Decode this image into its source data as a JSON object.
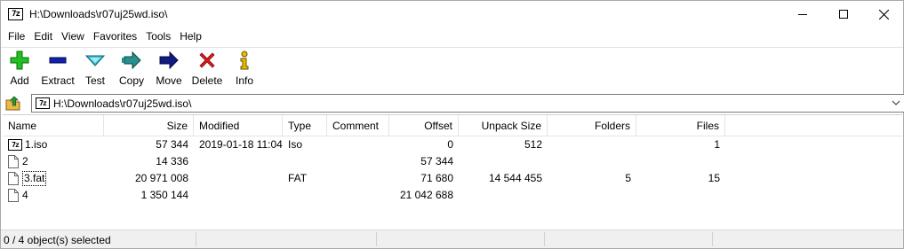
{
  "window": {
    "title": "H:\\Downloads\\r07uj25wd.iso\\",
    "app_icon_text": "7z"
  },
  "menu": [
    "File",
    "Edit",
    "View",
    "Favorites",
    "Tools",
    "Help"
  ],
  "toolbar": {
    "add": "Add",
    "extract": "Extract",
    "test": "Test",
    "copy": "Copy",
    "move": "Move",
    "delete": "Delete",
    "info": "Info"
  },
  "address": {
    "path": "H:\\Downloads\\r07uj25wd.iso\\"
  },
  "columns": {
    "name": "Name",
    "size": "Size",
    "modified": "Modified",
    "type": "Type",
    "comment": "Comment",
    "offset": "Offset",
    "unpack_size": "Unpack Size",
    "folders": "Folders",
    "files": "Files"
  },
  "rows": [
    {
      "name": "1.iso",
      "size": "57 344",
      "modified": "2019-01-18 11:04",
      "type": "Iso",
      "comment": "",
      "offset": "0",
      "unpack_size": "512",
      "folders": "",
      "files": "1",
      "icon": "iso-archive-icon"
    },
    {
      "name": "2",
      "size": "14 336",
      "modified": "",
      "type": "",
      "comment": "",
      "offset": "57 344",
      "unpack_size": "",
      "folders": "",
      "files": "",
      "icon": "file-icon"
    },
    {
      "name": "3.fat",
      "size": "20 971 008",
      "modified": "",
      "type": "FAT",
      "comment": "",
      "offset": "71 680",
      "unpack_size": "14 544 455",
      "folders": "5",
      "files": "15",
      "icon": "file-icon"
    },
    {
      "name": "4",
      "size": "1 350 144",
      "modified": "",
      "type": "",
      "comment": "",
      "offset": "21 042 688",
      "unpack_size": "",
      "folders": "",
      "files": "",
      "icon": "file-icon"
    }
  ],
  "status": {
    "selection": "0 / 4 object(s) selected"
  },
  "colors": {
    "add_green": "#22c022",
    "extract_blue": "#1020b0",
    "test_cyan": "#30c8d8",
    "copy_teal": "#2a8f8f",
    "move_navy": "#101a80",
    "delete_red": "#e01818",
    "info_yellow": "#e8c000"
  }
}
